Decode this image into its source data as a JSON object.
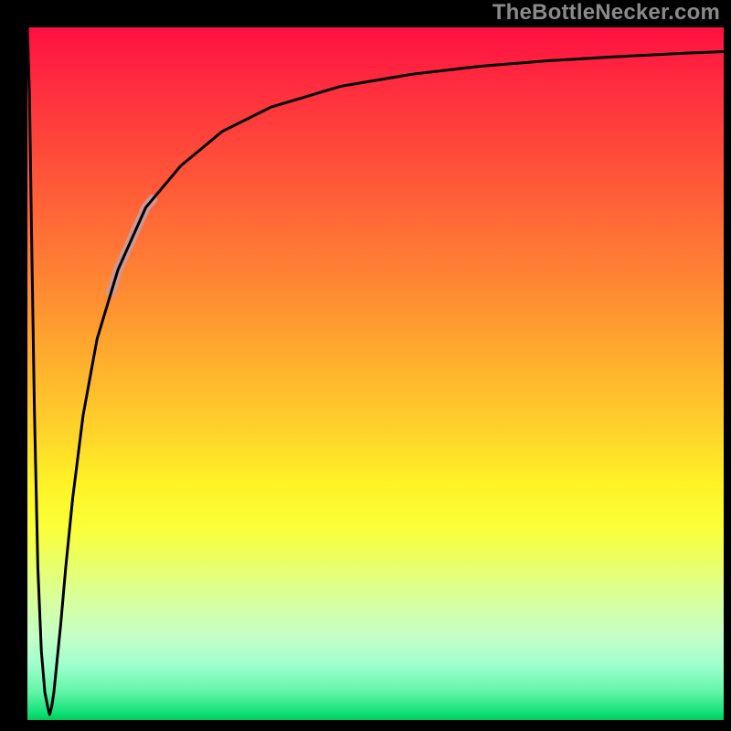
{
  "watermark": {
    "text": "TheBottleNecker.com"
  },
  "chart_data": {
    "type": "line",
    "title": "",
    "xlabel": "",
    "ylabel": "",
    "xlim": [
      0,
      100
    ],
    "ylim": [
      0,
      100
    ],
    "grid": false,
    "legend": null,
    "background": {
      "kind": "vertical-gradient",
      "top_color": "#ff1042",
      "mid_color": "#fff326",
      "bottom_color": "#00cc55"
    },
    "x": [
      0,
      0.3,
      0.6,
      1.0,
      1.5,
      2.0,
      2.5,
      3.0,
      3.2,
      3.5,
      3.8,
      4.2,
      4.8,
      5.5,
      6.5,
      8,
      10,
      13,
      17,
      22,
      28,
      35,
      45,
      55,
      65,
      75,
      85,
      95,
      100
    ],
    "values": [
      100,
      90,
      70,
      45,
      22,
      10,
      4,
      1.5,
      0.8,
      2,
      4,
      8,
      14,
      22,
      32,
      44,
      55,
      65,
      74,
      80,
      85,
      88.5,
      91.5,
      93.2,
      94.4,
      95.2,
      95.8,
      96.3,
      96.5
    ],
    "highlight_segment": {
      "x_range": [
        12,
        18
      ],
      "color": "#c99a9a",
      "width": 10
    },
    "colors": {
      "curve": "#000000"
    }
  }
}
